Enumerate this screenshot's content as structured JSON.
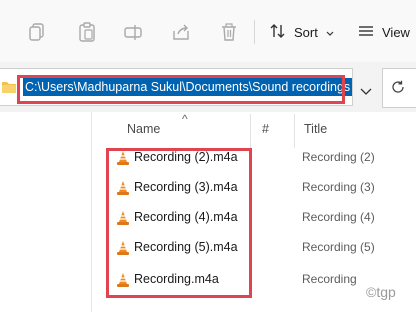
{
  "toolbar": {
    "sort_label": "Sort",
    "view_label": "View"
  },
  "address": {
    "path": "C:\\Users\\Madhuparna Sukul\\Documents\\Sound recordings"
  },
  "columns": {
    "name": "Name",
    "number": "#",
    "title": "Title"
  },
  "files": [
    {
      "name": "Recording (2).m4a",
      "title": "Recording (2)"
    },
    {
      "name": "Recording (3).m4a",
      "title": "Recording (3)"
    },
    {
      "name": "Recording (4).m4a",
      "title": "Recording (4)"
    },
    {
      "name": "Recording (5).m4a",
      "title": "Recording (5)"
    },
    {
      "name": "Recording.m4a",
      "title": "Recording"
    }
  ],
  "watermark": "©tgp",
  "colors": {
    "selection": "#0063b1",
    "highlight_box": "#e0454f",
    "vlc_orange": "#f08a1c"
  },
  "icons": [
    "copy-icon",
    "paste-icon",
    "rename-icon",
    "share-icon",
    "delete-icon",
    "sort-icon",
    "view-icon",
    "folder-icon",
    "chevron-down-icon",
    "refresh-icon",
    "vlc-cone-icon"
  ]
}
